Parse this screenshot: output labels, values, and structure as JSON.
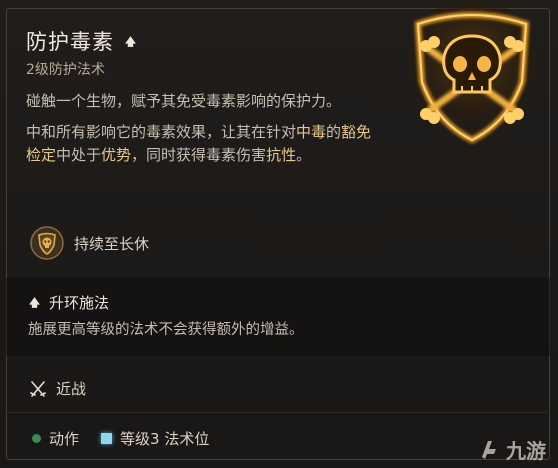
{
  "spell": {
    "name": "防护毒素",
    "level": "2级防护法术"
  },
  "description": {
    "p1": "碰触一个生物，赋予其免受毒素影响的保护力。",
    "p2_parts": [
      {
        "text": "中和所有影响它的毒素效果，让其在针对",
        "hl": false
      },
      {
        "text": "中毒",
        "hl": true
      },
      {
        "text": "的",
        "hl": false
      },
      {
        "text": "豁免检定",
        "hl": true
      },
      {
        "text": "中处于",
        "hl": false
      },
      {
        "text": "优势",
        "hl": true
      },
      {
        "text": "，同时获得毒素伤害",
        "hl": false
      },
      {
        "text": "抗性",
        "hl": true
      },
      {
        "text": "。",
        "hl": false
      }
    ]
  },
  "duration": {
    "label": "持续至长休",
    "icon": "skull-shield-icon"
  },
  "upcast": {
    "title": "升环施法",
    "body": "施展更高等级的法术不会获得额外的增益。"
  },
  "range": {
    "label": "近战",
    "icon": "crossed-swords-icon"
  },
  "cost": {
    "action_label": "动作",
    "slot_label": "等级3 法术位",
    "action_color": "#3d8b4f",
    "slot_color": "#8fd6f0"
  },
  "watermark": {
    "text": "九游"
  },
  "colors": {
    "highlight": "#eac78a",
    "emblem_gold": "#f0a020"
  }
}
